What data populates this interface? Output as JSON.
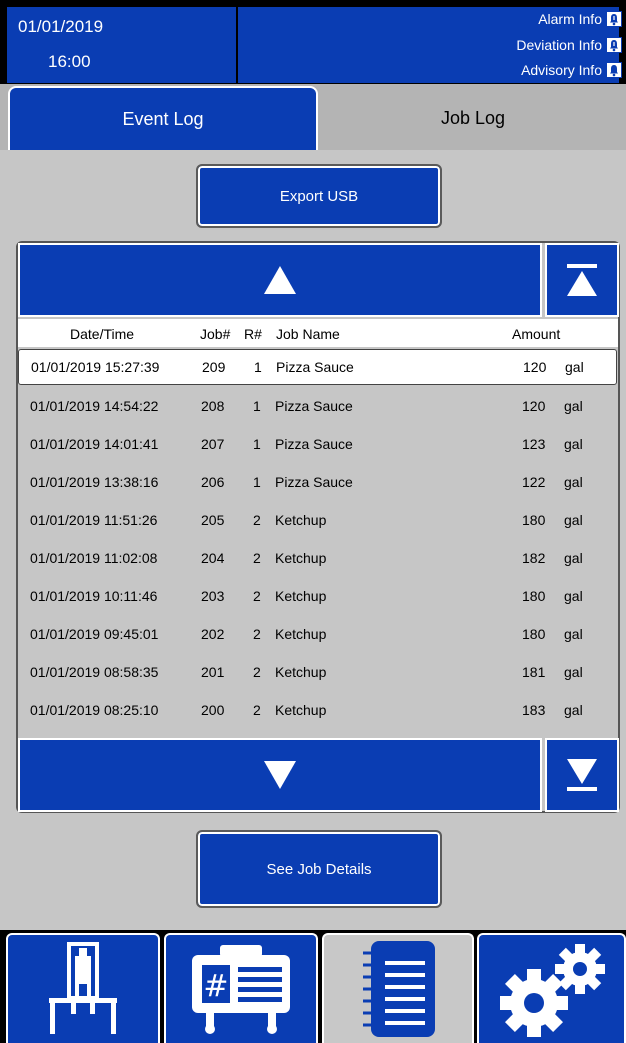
{
  "header": {
    "date": "01/01/2019",
    "time": "16:00",
    "alarm_label": "Alarm Info",
    "deviation_label": "Deviation Info",
    "advisory_label": "Advisory Info"
  },
  "tabs": [
    {
      "label": "Event Log",
      "active": false
    },
    {
      "label": "Job Log",
      "active": true
    }
  ],
  "export_button": "Export USB",
  "details_button": "See Job Details",
  "columns": {
    "datetime": "Date/Time",
    "job": "Job#",
    "r": "R#",
    "name": "Job Name",
    "amount": "Amount"
  },
  "rows": [
    {
      "datetime": "01/01/2019 15:27:39",
      "job": "209",
      "r": "1",
      "name": "Pizza Sauce",
      "amount": "120",
      "unit": "gal",
      "selected": true
    },
    {
      "datetime": "01/01/2019 14:54:22",
      "job": "208",
      "r": "1",
      "name": "Pizza Sauce",
      "amount": "120",
      "unit": "gal"
    },
    {
      "datetime": "01/01/2019 14:01:41",
      "job": "207",
      "r": "1",
      "name": "Pizza Sauce",
      "amount": "123",
      "unit": "gal"
    },
    {
      "datetime": "01/01/2019 13:38:16",
      "job": "206",
      "r": "1",
      "name": "Pizza Sauce",
      "amount": "122",
      "unit": "gal"
    },
    {
      "datetime": "01/01/2019 11:51:26",
      "job": "205",
      "r": "2",
      "name": "Ketchup",
      "amount": "180",
      "unit": "gal"
    },
    {
      "datetime": "01/01/2019 11:02:08",
      "job": "204",
      "r": "2",
      "name": "Ketchup",
      "amount": "182",
      "unit": "gal"
    },
    {
      "datetime": "01/01/2019 10:11:46",
      "job": "203",
      "r": "2",
      "name": "Ketchup",
      "amount": "180",
      "unit": "gal"
    },
    {
      "datetime": "01/01/2019 09:45:01",
      "job": "202",
      "r": "2",
      "name": "Ketchup",
      "amount": "180",
      "unit": "gal"
    },
    {
      "datetime": "01/01/2019 08:58:35",
      "job": "201",
      "r": "2",
      "name": "Ketchup",
      "amount": "181",
      "unit": "gal"
    },
    {
      "datetime": "01/01/2019 08:25:10",
      "job": "200",
      "r": "2",
      "name": "Ketchup",
      "amount": "183",
      "unit": "gal"
    }
  ],
  "bottom_nav": [
    {
      "icon": "lift-icon",
      "active": false
    },
    {
      "icon": "job-card-icon",
      "active": false
    },
    {
      "icon": "notebook-icon",
      "active": true
    },
    {
      "icon": "gears-icon",
      "active": false
    }
  ],
  "colors": {
    "primary_blue": "#0a3db3",
    "panel_gray": "#c6c6c6"
  }
}
